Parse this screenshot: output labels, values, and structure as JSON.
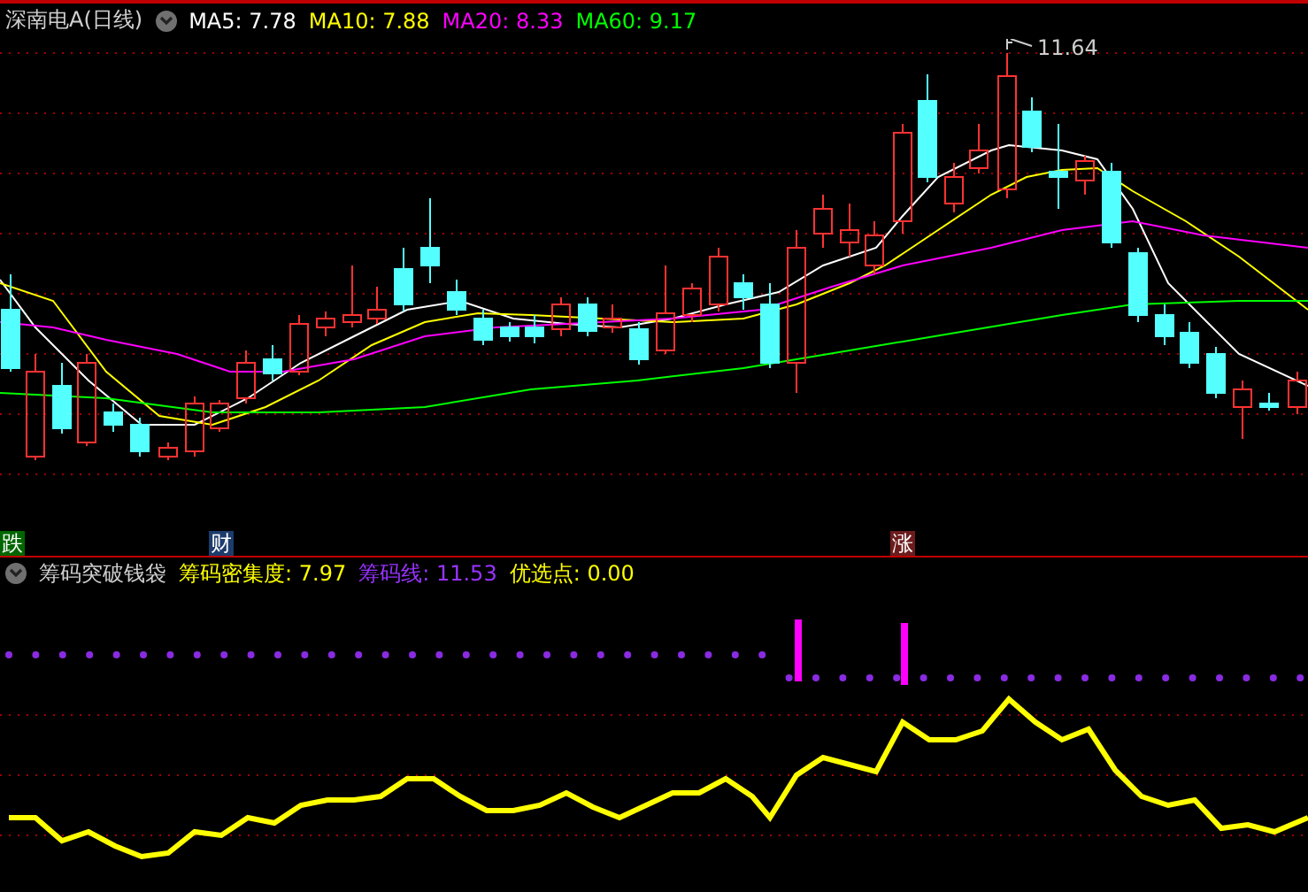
{
  "chart_title": "深南电A(日线)",
  "moving_averages": [
    {
      "label": "MA5:",
      "value": "7.78",
      "color": "#ffffff"
    },
    {
      "label": "MA10:",
      "value": "7.88",
      "color": "#ffff00"
    },
    {
      "label": "MA20:",
      "value": "8.33",
      "color": "#ff00ff"
    },
    {
      "label": "MA60:",
      "value": "9.17",
      "color": "#00ff00"
    }
  ],
  "peak_label": "11.64",
  "event_markers": [
    {
      "label": "跌",
      "color": "#006600"
    },
    {
      "label": "财",
      "color": "#1c3c6c"
    },
    {
      "label": "涨",
      "color": "#6c1c1c"
    }
  ],
  "indicator": {
    "title": "筹码突破钱袋",
    "values": [
      {
        "label": "筹码密集度:",
        "value": "7.97",
        "color": "#ffff00"
      },
      {
        "label": "筹码线:",
        "value": "11.53",
        "color": "#9933ff"
      },
      {
        "label": "优选点:",
        "value": "0.00",
        "color": "#ffff00"
      }
    ]
  }
}
